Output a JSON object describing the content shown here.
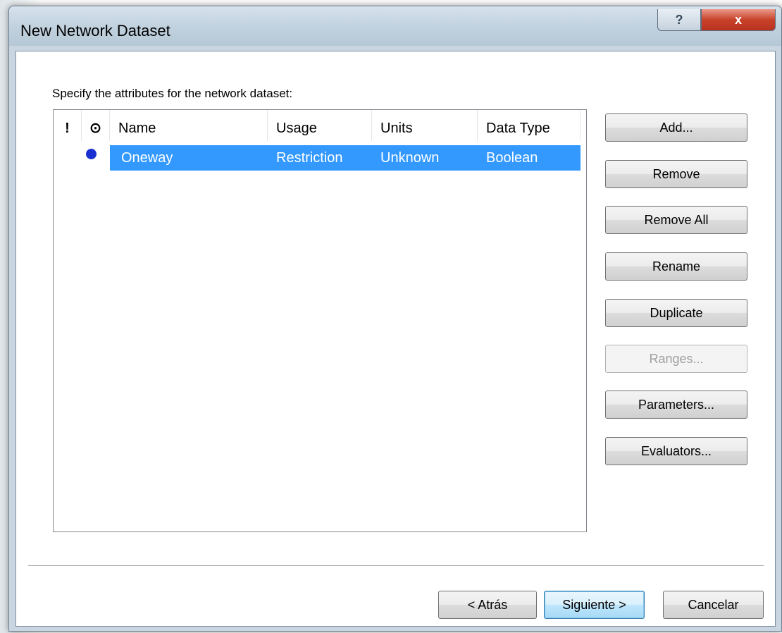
{
  "window": {
    "title": "New Network Dataset",
    "help_label": "?",
    "close_label": "x"
  },
  "instruction": "Specify the attributes for the network dataset:",
  "table": {
    "icon_headers": [
      "!",
      "⊙"
    ],
    "columns": [
      "Name",
      "Usage",
      "Units",
      "Data Type"
    ],
    "rows": [
      {
        "name": "Oneway",
        "usage": "Restriction",
        "units": "Unknown",
        "data_type": "Boolean",
        "selected": true
      }
    ]
  },
  "side_buttons": {
    "add": "Add...",
    "remove": "Remove",
    "remove_all": "Remove All",
    "rename": "Rename",
    "duplicate": "Duplicate",
    "ranges": "Ranges...",
    "parameters": "Parameters...",
    "evaluators": "Evaluators..."
  },
  "nav": {
    "back": "< Atrás",
    "next": "Siguiente >",
    "cancel": "Cancelar"
  },
  "colors": {
    "selection": "#3399ff",
    "restriction_icon": "#1a2fd0",
    "close_button": "#c8412a"
  }
}
